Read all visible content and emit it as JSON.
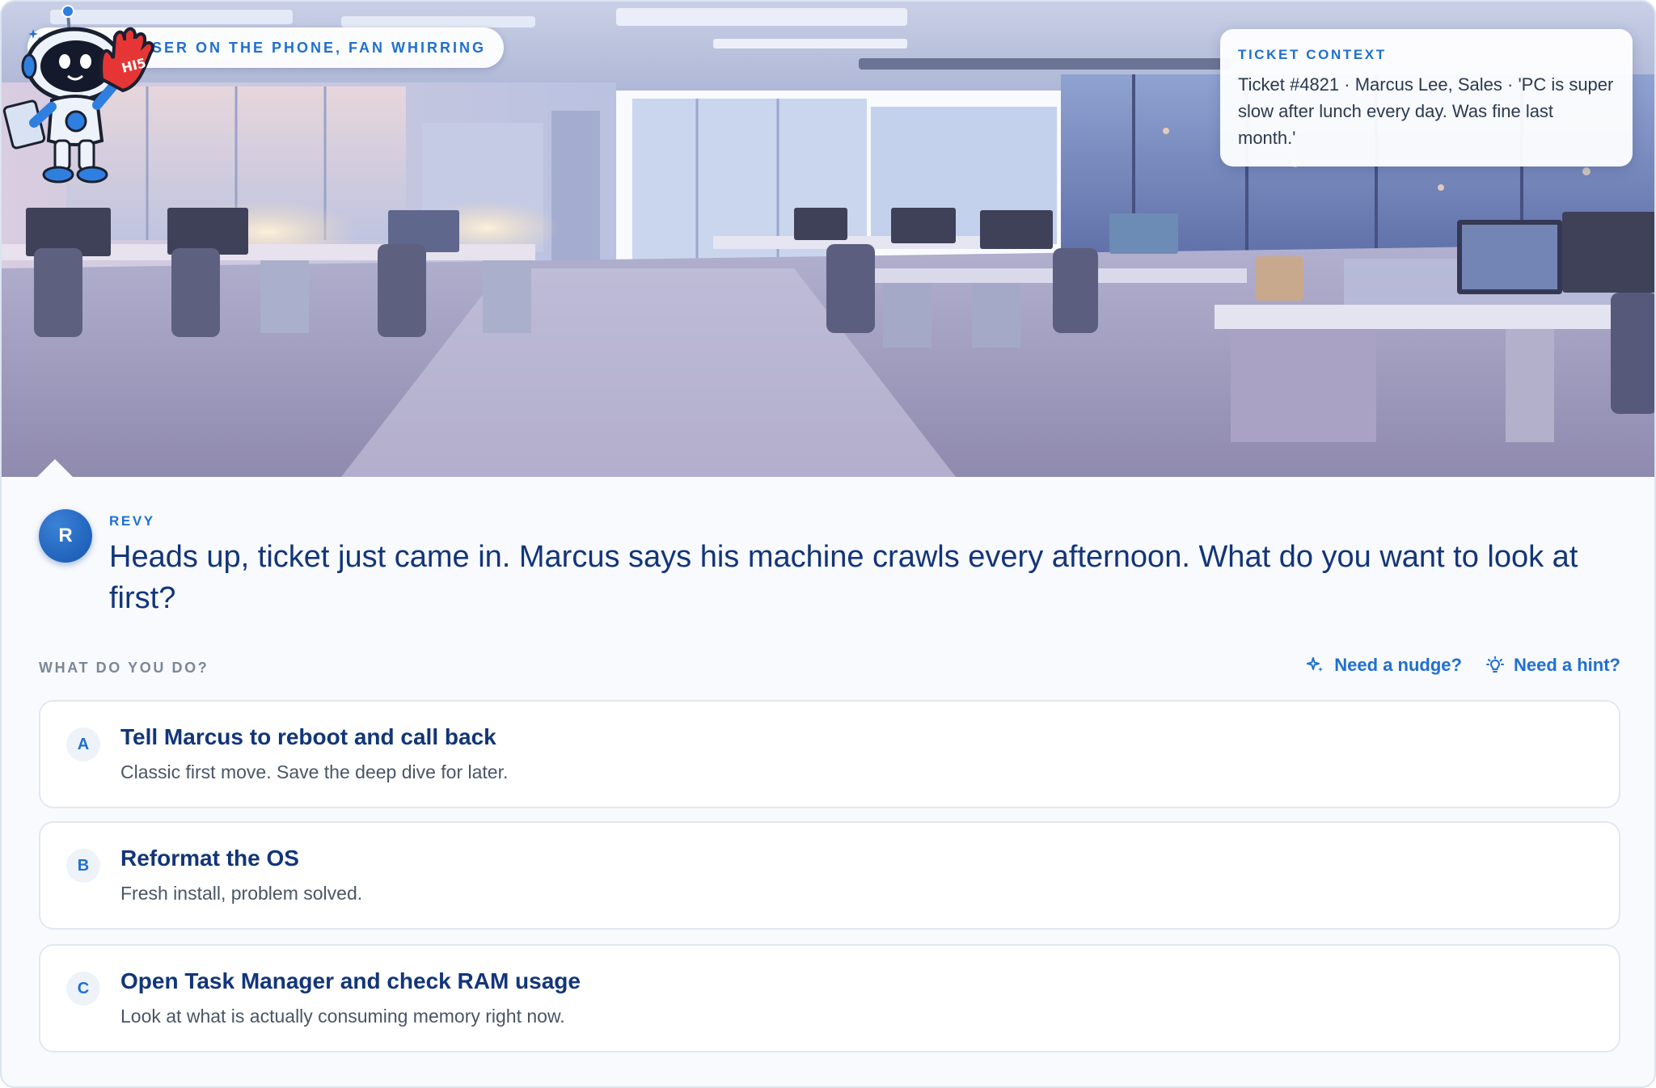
{
  "scene": {
    "location_label": "CUBICLE: USER ON THE PHONE, FAN WHIRRING",
    "context": {
      "label": "TICKET CONTEXT",
      "text": "Ticket #4821 · Marcus Lee, Sales · 'PC is super slow after lunch every day. Was fine last month.'"
    },
    "mascot_sign_text": "HI5"
  },
  "dialogue": {
    "avatar_initial": "R",
    "speaker": "REVY",
    "line": "Heads up, ticket just came in. Marcus says his machine crawls every afternoon. What do you want to look at first?"
  },
  "choices": {
    "prompt": "WHAT DO YOU DO?",
    "nudge_label": "Need a nudge?",
    "hint_label": "Need a hint?",
    "options": [
      {
        "letter": "A",
        "title": "Tell Marcus to reboot and call back",
        "description": "Classic first move. Save the deep dive for later."
      },
      {
        "letter": "B",
        "title": "Reformat the OS",
        "description": "Fresh install, problem solved."
      },
      {
        "letter": "C",
        "title": "Open Task Manager and check RAM usage",
        "description": "Look at what is actually consuming memory right now."
      }
    ]
  },
  "colors": {
    "accent": "#1f6fd1",
    "heading": "#12357a",
    "muted": "#7a8799"
  }
}
